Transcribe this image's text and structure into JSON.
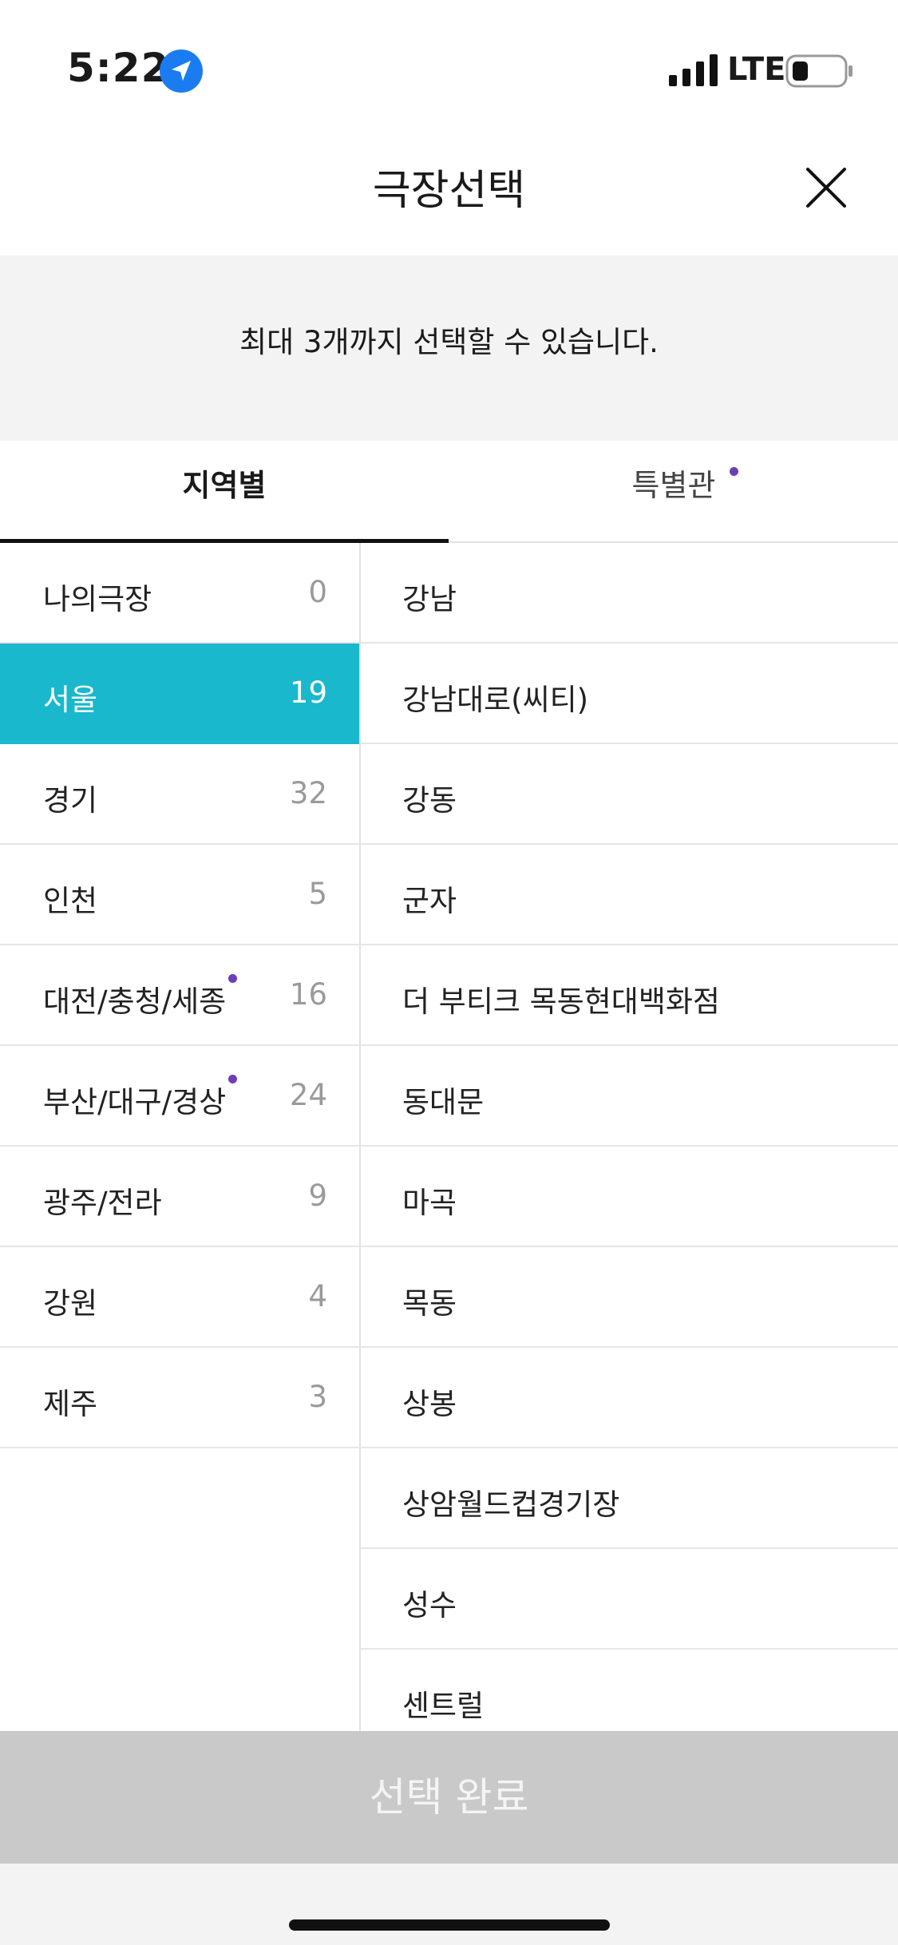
{
  "status_bar": {
    "time": "5:22",
    "network": "LTE",
    "icons": [
      "location-arrow-icon",
      "signal-icon",
      "battery-icon"
    ]
  },
  "header": {
    "title": "극장선택",
    "close_icon": "close-icon"
  },
  "notice": {
    "text": "최대 3개까지 선택할 수 있습니다."
  },
  "tabs": [
    {
      "label": "지역별",
      "active": true,
      "dot": false
    },
    {
      "label": "특별관",
      "active": false,
      "dot": true
    }
  ],
  "regions": [
    {
      "name": "나의극장",
      "count": "0",
      "selected": false,
      "dot": false
    },
    {
      "name": "서울",
      "count": "19",
      "selected": true,
      "dot": false
    },
    {
      "name": "경기",
      "count": "32",
      "selected": false,
      "dot": false
    },
    {
      "name": "인천",
      "count": "5",
      "selected": false,
      "dot": false
    },
    {
      "name": "대전/충청/세종",
      "count": "16",
      "selected": false,
      "dot": true
    },
    {
      "name": "부산/대구/경상",
      "count": "24",
      "selected": false,
      "dot": true
    },
    {
      "name": "광주/전라",
      "count": "9",
      "selected": false,
      "dot": false
    },
    {
      "name": "강원",
      "count": "4",
      "selected": false,
      "dot": false
    },
    {
      "name": "제주",
      "count": "3",
      "selected": false,
      "dot": false
    }
  ],
  "theaters": [
    "강남",
    "강남대로(씨티)",
    "강동",
    "군자",
    "더 부티크 목동현대백화점",
    "동대문",
    "마곡",
    "목동",
    "상봉",
    "상암월드컵경기장",
    "성수",
    "센트럴"
  ],
  "footer": {
    "done_label": "선택 완료"
  },
  "colors": {
    "selected_region_bg": "#19b8cc",
    "dot": "#6b3fb7",
    "disabled_button": "#c9c9c9"
  }
}
